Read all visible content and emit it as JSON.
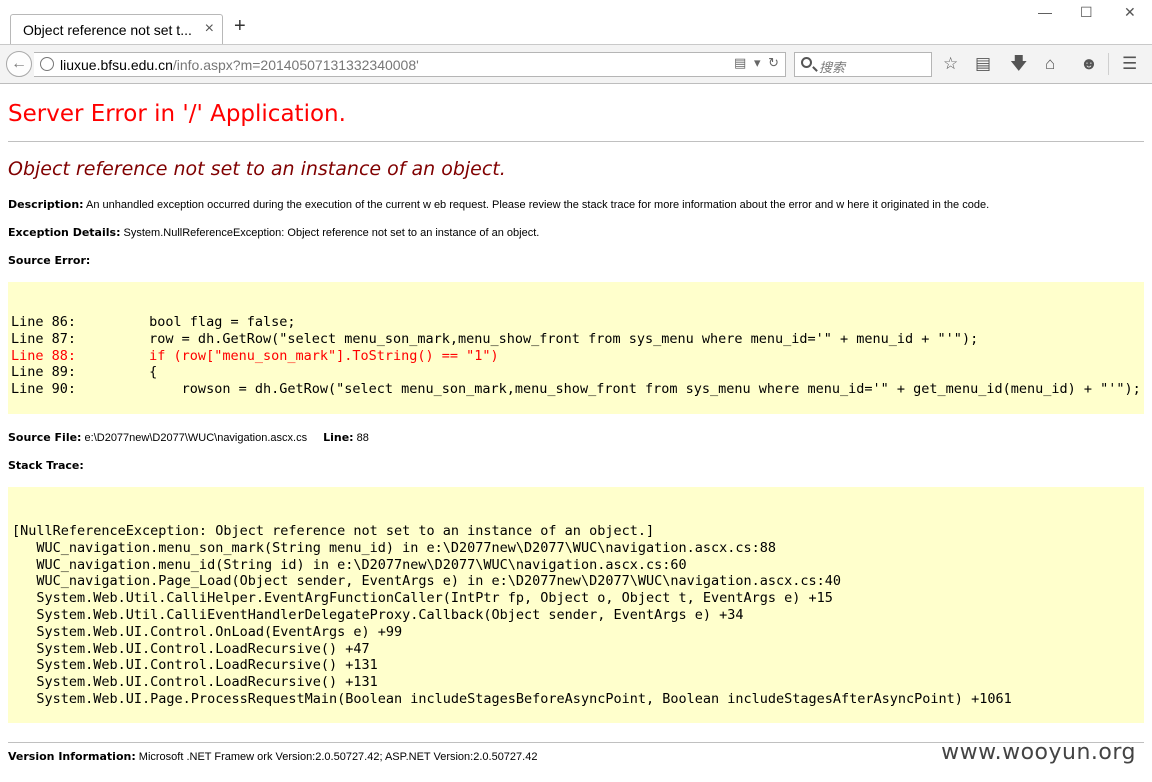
{
  "browser": {
    "tab_title": "Object reference not set t...",
    "tab_close": "×",
    "new_tab": "+",
    "window_minimize": "—",
    "window_maximize": "☐",
    "window_close": "✕",
    "url_host": "liuxue.bfsu.edu.cn",
    "url_path": "/info.aspx?m=20140507131332340008'",
    "search_placeholder": "搜索",
    "icons": [
      "back-icon",
      "globe-icon",
      "reader-icon",
      "dropdown-icon",
      "reload-icon",
      "search-icon",
      "bookmark-star-icon",
      "reading-list-icon",
      "download-icon",
      "home-icon",
      "smiley-icon",
      "menu-icon"
    ]
  },
  "page": {
    "heading": "Server Error in '/' Application.",
    "error_message": "Object reference not set to an instance of an object.",
    "description_label": "Description:",
    "description_text": " An unhandled exception occurred during the execution of the current w eb request. Please review  the stack trace for more information about the error and w here it originated in the code.",
    "exception_label": "Exception Details:",
    "exception_text": " System.NullReferenceException: Object reference not set to an instance of an object.",
    "source_error_label": "Source Error:",
    "source_lines": [
      {
        "text": "Line 86:         bool flag = false;",
        "highlight": false
      },
      {
        "text": "Line 87:         row = dh.GetRow(\"select menu_son_mark,menu_show_front from sys_menu where menu_id='\" + menu_id + \"'\");",
        "highlight": false
      },
      {
        "text": "Line 88:         if (row[\"menu_son_mark\"].ToString() == \"1\")",
        "highlight": true
      },
      {
        "text": "Line 89:         {",
        "highlight": false
      },
      {
        "text": "Line 90:             rowson = dh.GetRow(\"select menu_son_mark,menu_show_front from sys_menu where menu_id='\" + get_menu_id(menu_id) + \"'\");",
        "highlight": false
      }
    ],
    "source_file_label": "Source File:",
    "source_file_value": " e:\\D2077new\\D2077\\WUC\\navigation.ascx.cs",
    "line_label": "Line:",
    "line_value": " 88",
    "stack_trace_label": "Stack Trace:",
    "stack_lines": [
      "[NullReferenceException: Object reference not set to an instance of an object.]",
      "   WUC_navigation.menu_son_mark(String menu_id) in e:\\D2077new\\D2077\\WUC\\navigation.ascx.cs:88",
      "   WUC_navigation.menu_id(String id) in e:\\D2077new\\D2077\\WUC\\navigation.ascx.cs:60",
      "   WUC_navigation.Page_Load(Object sender, EventArgs e) in e:\\D2077new\\D2077\\WUC\\navigation.ascx.cs:40",
      "   System.Web.Util.CalliHelper.EventArgFunctionCaller(IntPtr fp, Object o, Object t, EventArgs e) +15",
      "   System.Web.Util.CalliEventHandlerDelegateProxy.Callback(Object sender, EventArgs e) +34",
      "   System.Web.UI.Control.OnLoad(EventArgs e) +99",
      "   System.Web.UI.Control.LoadRecursive() +47",
      "   System.Web.UI.Control.LoadRecursive() +131",
      "   System.Web.UI.Control.LoadRecursive() +131",
      "   System.Web.UI.Page.ProcessRequestMain(Boolean includeStagesBeforeAsyncPoint, Boolean includeStagesAfterAsyncPoint) +1061"
    ],
    "version_label": "Version Information:",
    "version_text": " Microsoft .NET Framew ork Version:2.0.50727.42; ASP.NET Version:2.0.50727.42"
  },
  "watermark": "www.wooyun.org",
  "colors": {
    "heading_red": "#ff0000",
    "message_maroon": "#800000",
    "code_background": "#ffffcc"
  }
}
